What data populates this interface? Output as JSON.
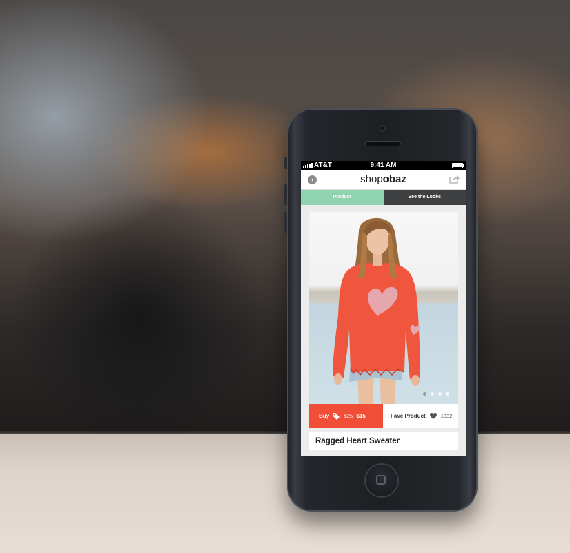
{
  "status_bar": {
    "carrier": "AT&T",
    "time": "9:41 AM"
  },
  "navbar": {
    "back_icon": "back-arrow-icon",
    "logo_prefix": "shop",
    "logo_suffix": "obaz",
    "share_icon": "share-icon"
  },
  "tabs": [
    {
      "label": "Product",
      "active": true
    },
    {
      "label": "See the Looks",
      "active": false
    }
  ],
  "product": {
    "carousel_dots": 4,
    "active_dot": 0,
    "buy_label": "Buy",
    "tag_icon": "price-tag-icon",
    "old_price": "$25",
    "new_price": "$15",
    "fave_label": "Fave Product",
    "heart_icon": "heart-icon",
    "fave_count": "1332",
    "title": "Ragged Heart Sweater"
  },
  "colors": {
    "product_tab": "#8fd3b0",
    "looks_tab": "#3f4042",
    "buy_button": "#f04e37",
    "sweater": "#f0553d",
    "heart_motif": "#e6a6ae"
  }
}
